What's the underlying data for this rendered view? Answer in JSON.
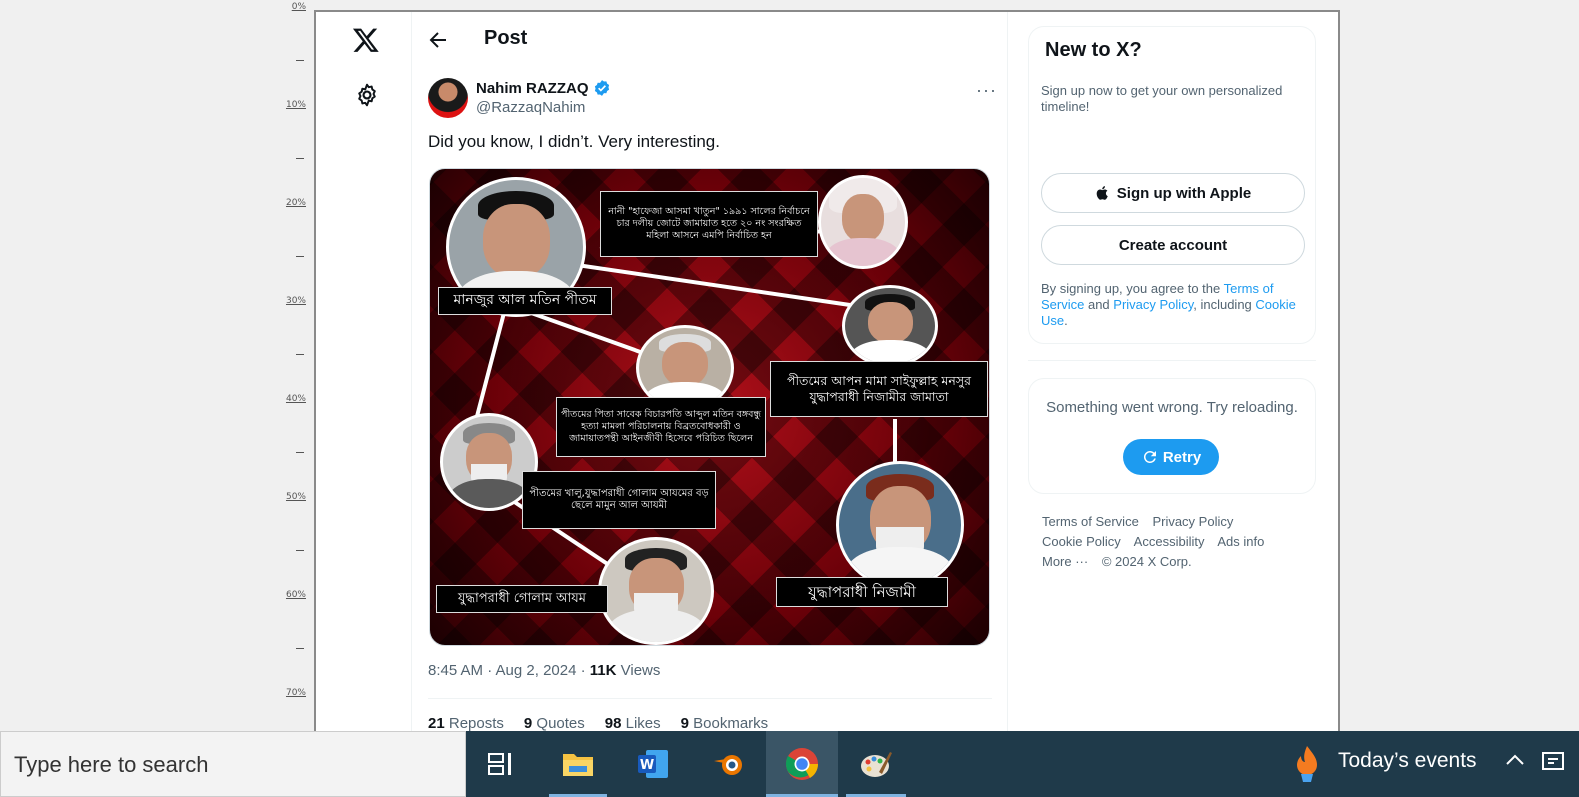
{
  "ruler": {
    "labels": [
      "0%",
      "10%",
      "20%",
      "30%",
      "40%",
      "50%",
      "60%",
      "70%"
    ]
  },
  "nav": {
    "logo_icon": "x-logo-icon",
    "settings_icon": "gear-icon"
  },
  "header": {
    "title": "Post",
    "back_icon": "arrow-left-icon"
  },
  "tweet": {
    "author_name": "Nahim RAZZAQ",
    "author_handle": "@RazzaqNahim",
    "text": "Did you know, I didn’t. Very interesting.",
    "timestamp": "8:45 AM · Aug 2, 2024 · ",
    "views_count": "11K",
    "views_label": " Views",
    "image_captions": {
      "top_left": "মানজুর আল মতিন পীতম",
      "top_box": "নানী \"হাফেজা আসমা খাতুন\" ১৯৯১ সালের নির্বাচনে চার দলীয় জোটে জামায়াত হতে ২০ নং সংরক্ষিত মহিলা আসনে এমপি নির্বাচিত হন",
      "mid_right": "পীতমের আপন মামা সাইফুল্লাহ মনসুর যুদ্ধাপরাধী নিজামীর জামাতা",
      "center": "পীতমের পিতা সাবেক বিচারপতি আব্দুল মতিন বঙ্গবন্ধু হত্যা মামলা পরিচালনায় বিব্রতবোধকারী ও জামায়াতপন্থী আইনজীবী হিসেবে পরিচিত ছিলেন",
      "mid_left": "পীতমের খালু,যুদ্ধাপরাধী গোলাম আযমের বড় ছেলে মামুন আল আযমী",
      "bottom_left": "যুদ্ধাপরাধী গোলাম আযম",
      "bottom_right": "যুদ্ধাপরাধী নিজামী"
    },
    "stats": [
      {
        "count": "21",
        "label": " Reposts"
      },
      {
        "count": "9",
        "label": " Quotes"
      },
      {
        "count": "98",
        "label": " Likes"
      },
      {
        "count": "9",
        "label": " Bookmarks"
      }
    ]
  },
  "sidebar": {
    "title": "New to X?",
    "subtitle": "Sign up now to get your own personalized timeline!",
    "apple_button": "Sign up with Apple",
    "create_button": "Create account",
    "legal_pre": "By signing up, you agree to the ",
    "legal_terms": "Terms of Service",
    "legal_and": " and ",
    "legal_privacy": "Privacy Policy",
    "legal_including": ", including ",
    "legal_cookie": "Cookie Use",
    "legal_end": ".",
    "error_text": "Something went wrong. Try reloading.",
    "retry_button": "Retry",
    "footer": [
      "Terms of Service",
      "Privacy Policy",
      "Cookie Policy",
      "Accessibility",
      "Ads info",
      "More ···",
      "© 2024 X Corp."
    ]
  },
  "taskbar": {
    "search_placeholder": "Type here to search",
    "events_label": "Today’s events",
    "icons": [
      "task-view-icon",
      "file-explorer-icon",
      "word-icon",
      "blender-icon",
      "chrome-icon",
      "paint-icon"
    ]
  },
  "colors": {
    "accent": "#1d9bf0",
    "taskbar": "#1f3a4a"
  }
}
